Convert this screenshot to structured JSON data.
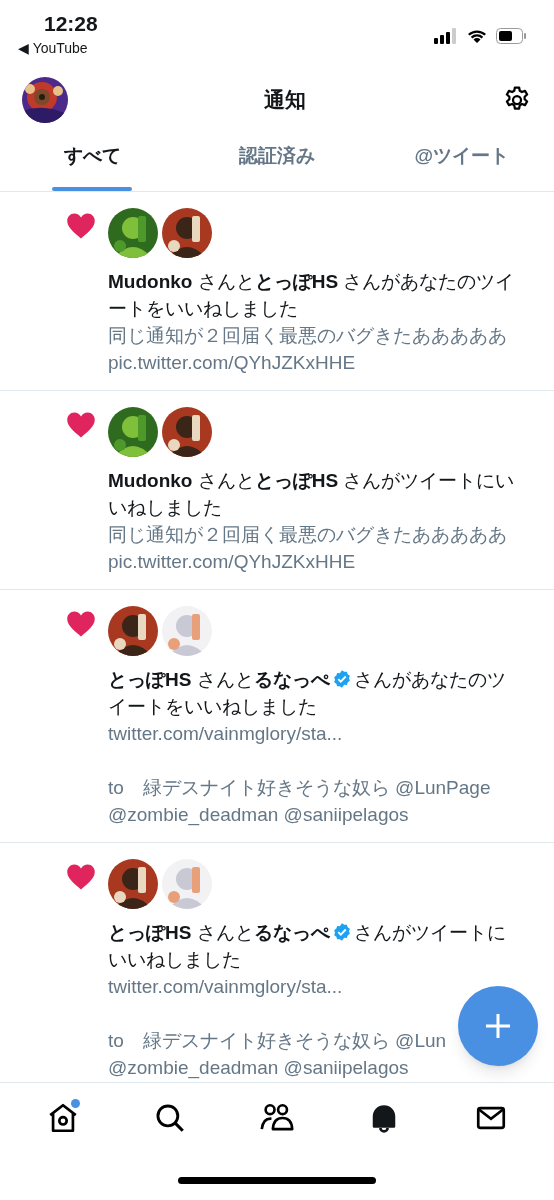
{
  "status_bar": {
    "time": "12:28",
    "back_link": "◀ YouTube"
  },
  "header": {
    "title": "通知"
  },
  "tabs": [
    {
      "label": "すべて",
      "selected": true
    },
    {
      "label": "認証済み",
      "selected": false
    },
    {
      "label": "@ツイート",
      "selected": false
    }
  ],
  "notifications": [
    {
      "avatars": [
        {
          "kind": "picture"
        },
        {
          "kind": "picture"
        }
      ],
      "message": [
        {
          "kind": "name",
          "text": "Mudonko"
        },
        {
          "kind": "text",
          "text": "さんと"
        },
        {
          "kind": "name",
          "text": "とっぽHS"
        },
        {
          "kind": "text",
          "text": "さんがあなたのツイートをいいねしました"
        }
      ],
      "preview": [
        [
          "同じ通知が２回届く最悪のバグきたあああああ",
          "pic.twitter.com/QYhJZKxHHE"
        ]
      ]
    },
    {
      "avatars": [
        {
          "kind": "picture"
        },
        {
          "kind": "picture"
        }
      ],
      "message": [
        {
          "kind": "name",
          "text": "Mudonko"
        },
        {
          "kind": "text",
          "text": "さんと"
        },
        {
          "kind": "name",
          "text": "とっぽHS"
        },
        {
          "kind": "text",
          "text": "さんがツイートにいいねしました"
        }
      ],
      "preview": [
        [
          "同じ通知が２回届く最悪のバグきたあああああ",
          "pic.twitter.com/QYhJZKxHHE"
        ]
      ]
    },
    {
      "avatars": [
        {
          "kind": "picture"
        },
        {
          "kind": "picture"
        }
      ],
      "message": [
        {
          "kind": "name",
          "text": "とっぽHS"
        },
        {
          "kind": "text",
          "text": "さんと"
        },
        {
          "kind": "name",
          "text": "るなっぺ",
          "verified": true
        },
        {
          "kind": "text",
          "text": "さんがあなたのツイートをいいねしました"
        }
      ],
      "preview": [
        [
          "twitter.com/vainmglory/sta..."
        ],
        [
          "to　緑デスナイト好きそうな奴ら @LunPage",
          "@zombie_deadman @saniipelagos"
        ]
      ]
    },
    {
      "avatars": [
        {
          "kind": "picture"
        },
        {
          "kind": "picture"
        }
      ],
      "message": [
        {
          "kind": "name",
          "text": "とっぽHS"
        },
        {
          "kind": "text",
          "text": "さんと"
        },
        {
          "kind": "name",
          "text": "るなっぺ",
          "verified": true
        },
        {
          "kind": "text",
          "text": "さんがツイートにいいねしました"
        }
      ],
      "preview": [
        [
          "twitter.com/vainmglory/sta..."
        ],
        [
          "to　緑デスナイト好きそうな奴ら @Lun",
          "@zombie_deadman @saniipelagos"
        ]
      ]
    }
  ],
  "nav": [
    {
      "kind": "home",
      "selected": false,
      "badge": true
    },
    {
      "kind": "search",
      "selected": false
    },
    {
      "kind": "people",
      "selected": false
    },
    {
      "kind": "bell",
      "selected": true
    },
    {
      "kind": "mail",
      "selected": false
    }
  ]
}
